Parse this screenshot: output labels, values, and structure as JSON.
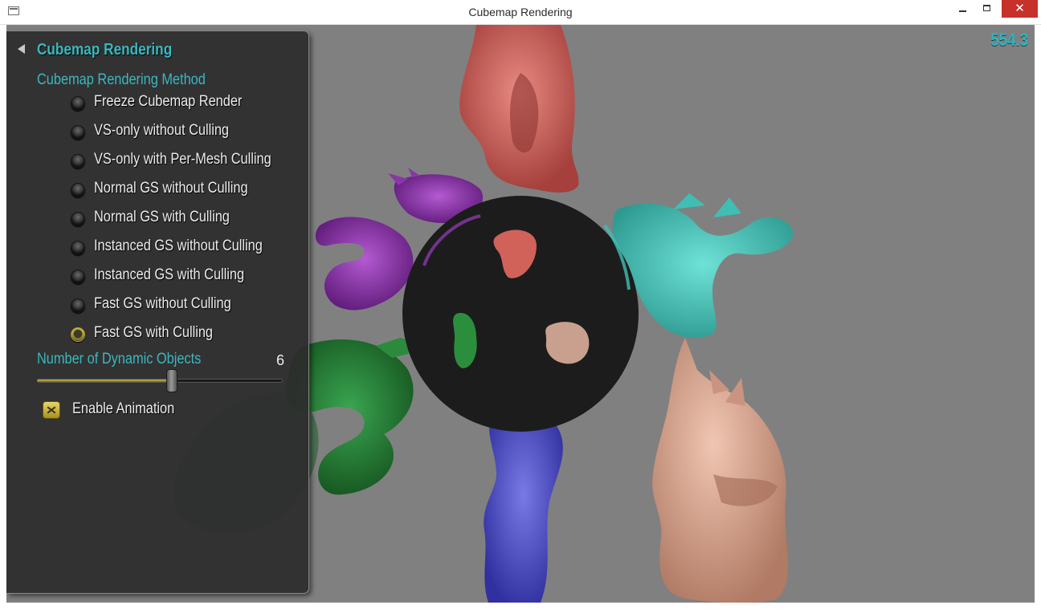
{
  "window": {
    "title": "Cubemap Rendering",
    "minimize_glyph": "minimize-icon",
    "maximize_glyph": "maximize-icon",
    "close_label": "✕"
  },
  "viewport": {
    "fps": "554.3",
    "background_color": "#808080"
  },
  "panel": {
    "title": "Cubemap Rendering",
    "method_heading": "Cubemap Rendering Method",
    "methods": [
      {
        "label": "Freeze Cubemap Render",
        "selected": false
      },
      {
        "label": "VS-only without Culling",
        "selected": false
      },
      {
        "label": "VS-only with Per-Mesh Culling",
        "selected": false
      },
      {
        "label": "Normal GS without Culling",
        "selected": false
      },
      {
        "label": "Normal GS with Culling",
        "selected": false
      },
      {
        "label": "Instanced GS without Culling",
        "selected": false
      },
      {
        "label": "Instanced GS with Culling",
        "selected": false
      },
      {
        "label": "Fast GS without Culling",
        "selected": false
      },
      {
        "label": "Fast GS with Culling",
        "selected": true
      }
    ],
    "objects_label": "Number of Dynamic Objects",
    "objects_value": "6",
    "objects_slider_fraction": 0.55,
    "animation_label": "Enable Animation",
    "animation_checked": true
  },
  "colors": {
    "accent": "#39b8bf",
    "dragon_top": "#d86a63",
    "dragon_purple": "#9438b3",
    "dragon_cyan": "#45cfc3",
    "dragon_green": "#2a8a3e",
    "dragon_blue": "#5a5ad6",
    "dragon_peach": "#e0ac96",
    "sphere": "#1c1c1c"
  }
}
